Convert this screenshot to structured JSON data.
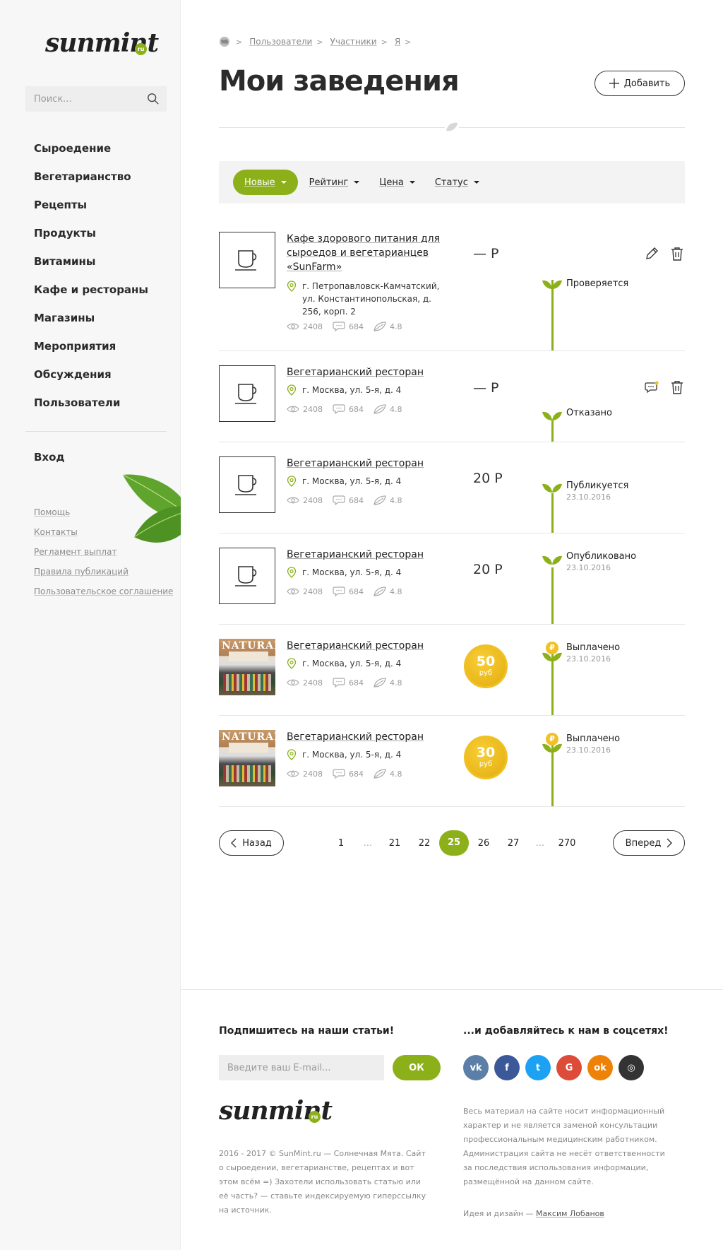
{
  "brand": {
    "name": "sunmint",
    "tld": "ru"
  },
  "search": {
    "placeholder": "Поиск..."
  },
  "nav": [
    "Сыроедение",
    "Вегетарианство",
    "Рецепты",
    "Продукты",
    "Витамины",
    "Кафе и рестораны",
    "Магазины",
    "Мероприятия",
    "Обсуждения",
    "Пользователи"
  ],
  "login": "Вход",
  "help_links": [
    "Помощь",
    "Контакты",
    "Регламент выплат",
    "Правила публикаций",
    "Пользовательское соглашение"
  ],
  "breadcrumbs": [
    "Пользователи",
    "Участники",
    "Я"
  ],
  "page_title": "Мои заведения",
  "add_button": "Добавить",
  "filters": [
    {
      "label": "Новые",
      "active": true
    },
    {
      "label": "Рейтинг",
      "active": false
    },
    {
      "label": "Цена",
      "active": false
    },
    {
      "label": "Статус",
      "active": false
    }
  ],
  "items": [
    {
      "name": "Кафе здорового питания для сыроедов и вегетарианцев «SunFarm»",
      "address": "г. Петропавловск-Камчатский, ул. Константинопольская, д. 256, корп. 2",
      "views": "2408",
      "comments": "684",
      "rating": "4.8",
      "price": "— Р",
      "status": "Проверяется",
      "date": "",
      "actions": [
        "edit-icon",
        "trash-icon"
      ]
    },
    {
      "name": "Вегетарианский ресторан",
      "address": "г. Москва, ул. 5-я, д. 4",
      "views": "2408",
      "comments": "684",
      "rating": "4.8",
      "price": "— Р",
      "status": "Отказано",
      "date": "",
      "actions": [
        "chat-icon",
        "trash-icon"
      ]
    },
    {
      "name": "Вегетарианский ресторан",
      "address": "г. Москва, ул. 5-я, д. 4",
      "views": "2408",
      "comments": "684",
      "rating": "4.8",
      "price": "20 Р",
      "status": "Публикуется",
      "date": "23.10.2016"
    },
    {
      "name": "Вегетарианский ресторан",
      "address": "г. Москва, ул. 5-я, д. 4",
      "views": "2408",
      "comments": "684",
      "rating": "4.8",
      "price": "20 Р",
      "status": "Опубликовано",
      "date": "23.10.2016"
    },
    {
      "name": "Вегетарианский ресторан",
      "address": "г. Москва, ул. 5-я, д. 4",
      "views": "2408",
      "comments": "684",
      "rating": "4.8",
      "coin_value": "50",
      "coin_unit": "руб",
      "status": "Выплачено",
      "date": "23.10.2016",
      "photo_sign": "NATURAL"
    },
    {
      "name": "Вегетарианский ресторан",
      "address": "г. Москва, ул. 5-я, д. 4",
      "views": "2408",
      "comments": "684",
      "rating": "4.8",
      "coin_value": "30",
      "coin_unit": "руб",
      "status": "Выплачено",
      "date": "23.10.2016",
      "photo_sign": "NATURAL"
    }
  ],
  "pagination": {
    "prev": "Назад",
    "next": "Вперед",
    "pages": [
      "1",
      "...",
      "21",
      "22",
      "25",
      "26",
      "27",
      "...",
      "270"
    ],
    "current": "25"
  },
  "footer": {
    "subscribe_title": "Подпишитесь на наши статьи!",
    "email_placeholder": "Введите ваш E-mail...",
    "ok": "ОК",
    "social_title": "...и добавляйтесь к нам в соцсетях!",
    "socials": [
      {
        "name": "vk",
        "glyph": "vk",
        "color": "#5b7fa6"
      },
      {
        "name": "facebook",
        "glyph": "f",
        "color": "#3b5998"
      },
      {
        "name": "twitter",
        "glyph": "t",
        "color": "#1da1f2"
      },
      {
        "name": "google",
        "glyph": "G",
        "color": "#dd4b39"
      },
      {
        "name": "odnoklassniki",
        "glyph": "ok",
        "color": "#ee8208"
      },
      {
        "name": "instagram",
        "glyph": "◎",
        "color": "#333333"
      }
    ],
    "about": "2016 - 2017 © SunMint.ru — Солнечная Мята. Сайт о сыроедении, вегетарианстве, рецептах и вот этом всём =) Захотели использовать статью или её часть? — ставьте индексируемую гиперссылку на источник.",
    "disclaimer": "Весь материал на сайте носит информационный характер и не является заменой консультации профессиональным медицинским работником. Администрация сайта не несёт ответственности за последствия использования информации, размещённой на данном сайте.",
    "credit_prefix": "Идея и дизайн — ",
    "credit_author": "Максим Лобанов"
  },
  "colors": {
    "accent": "#8cb019",
    "coin": "#f1c024"
  }
}
